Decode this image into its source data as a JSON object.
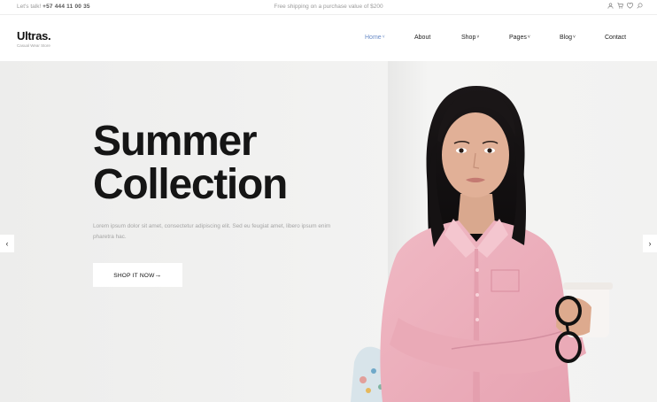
{
  "topbar": {
    "contact_prefix": "Let's talk!",
    "phone": "+57 444 11 00 35",
    "promo": "Free shipping on a purchase value of $200",
    "icons": [
      "user-icon",
      "cart-icon",
      "heart-icon",
      "search-icon"
    ]
  },
  "header": {
    "logo": "Ultras.",
    "tagline": "Casual Wear Store",
    "nav": [
      {
        "label": "Home",
        "dropdown": true,
        "active": true
      },
      {
        "label": "About",
        "dropdown": false
      },
      {
        "label": "Shop",
        "dropdown": true
      },
      {
        "label": "Pages",
        "dropdown": true
      },
      {
        "label": "Blog",
        "dropdown": true
      },
      {
        "label": "Contact",
        "dropdown": false
      }
    ]
  },
  "hero": {
    "title_line1": "Summer",
    "title_line2": "Collection",
    "description": "Lorem ipsum dolor sit amet, consectetur adipiscing elit. Sed eu feugiat amet, libero ipsum enim pharetra hac.",
    "cta_label": "SHOP IT NOW",
    "cta_arrow": "→",
    "prev_arrow": "‹",
    "next_arrow": "›"
  },
  "colors": {
    "accent": "#6a8cc7",
    "shirt": "#eeb1bd",
    "hero_bg": "#f0f0ef"
  }
}
